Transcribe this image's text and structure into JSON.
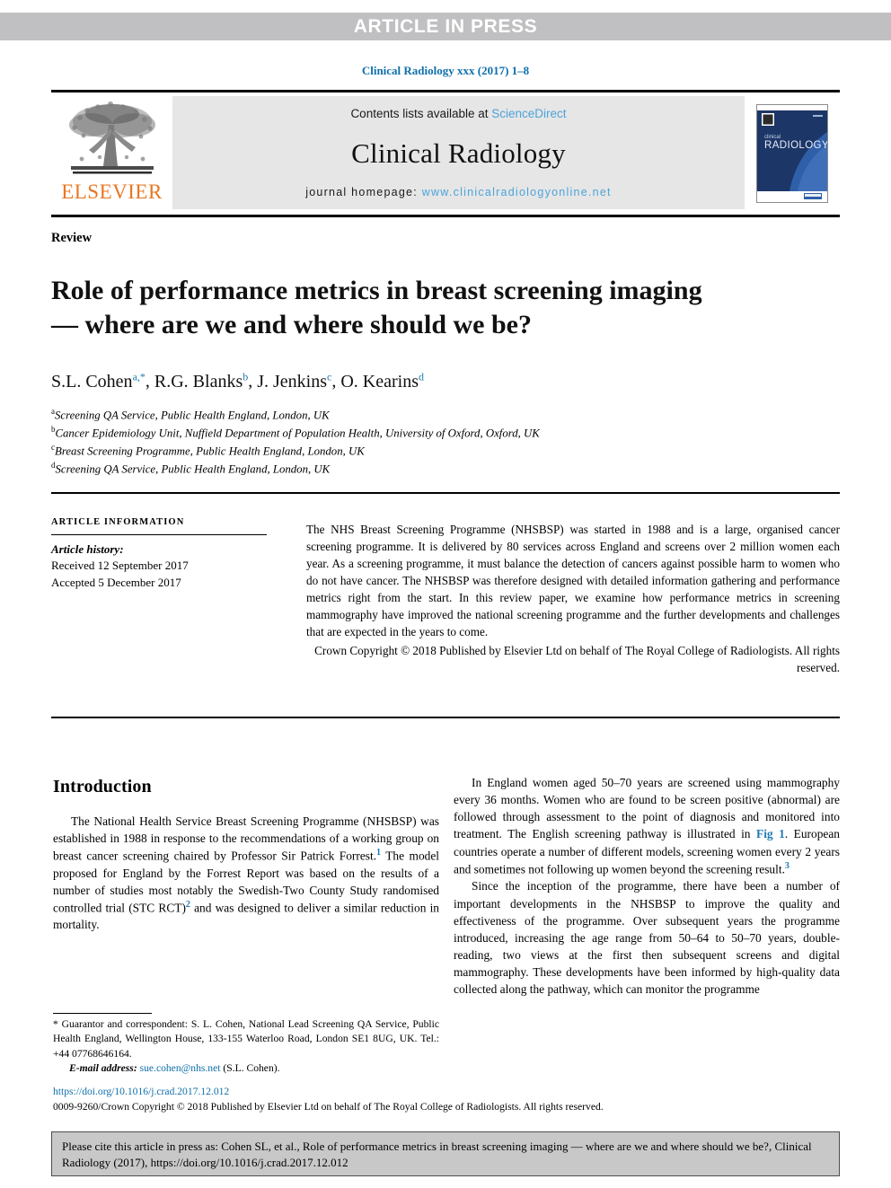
{
  "banner": {
    "text": "ARTICLE IN PRESS"
  },
  "journal_ref": "Clinical Radiology xxx (2017) 1–8",
  "masthead": {
    "publisher_word": "ELSEVIER",
    "contents_prefix": "Contents lists available at ",
    "contents_link": "ScienceDirect",
    "journal_name": "Clinical Radiology",
    "homepage_prefix": "journal homepage: ",
    "homepage_link": "www.clinicalradiologyonline.net",
    "cover_title_small": "clinical",
    "cover_title_large": "RADIOLOGY"
  },
  "article": {
    "section_label": "Review",
    "title": "Role of performance metrics in breast screening imaging — where are we and where should we be?",
    "authors": [
      {
        "name": "S.L. Cohen",
        "marks": "a,",
        "star": true
      },
      {
        "name": "R.G. Blanks",
        "marks": "b",
        "star": false
      },
      {
        "name": "J. Jenkins",
        "marks": "c",
        "star": false
      },
      {
        "name": "O. Kearins",
        "marks": "d",
        "star": false
      }
    ],
    "affiliations": [
      {
        "mark": "a",
        "text": "Screening QA Service, Public Health England, London, UK"
      },
      {
        "mark": "b",
        "text": "Cancer Epidemiology Unit, Nuffield Department of Population Health, University of Oxford, Oxford, UK"
      },
      {
        "mark": "c",
        "text": "Breast Screening Programme, Public Health England, London, UK"
      },
      {
        "mark": "d",
        "text": "Screening QA Service, Public Health England, London, UK"
      }
    ]
  },
  "article_information": {
    "heading": "ARTICLE INFORMATION",
    "history_label": "Article history:",
    "received": "Received 12 September 2017",
    "accepted": "Accepted 5 December 2017"
  },
  "abstract": {
    "text": "The NHS Breast Screening Programme (NHSBSP) was started in 1988 and is a large, organised cancer screening programme. It is delivered by 80 services across England and screens over 2 million women each year. As a screening programme, it must balance the detection of cancers against possible harm to women who do not have cancer. The NHSBSP was therefore designed with detailed information gathering and performance metrics right from the start. In this review paper, we examine how performance metrics in screening mammography have improved the national screening programme and the further developments and challenges that are expected in the years to come.",
    "copyright": "Crown Copyright © 2018 Published by Elsevier Ltd on behalf of The Royal College of Radiologists. All rights reserved."
  },
  "body": {
    "intro_heading": "Introduction",
    "left_p1_a": "The National Health Service Breast Screening Programme (NHSBSP) was established in 1988 in response to the recommendations of a working group on breast cancer screening chaired by Professor Sir Patrick Forrest.",
    "left_p1_ref1": "1",
    "left_p1_b": " The model proposed for England by the Forrest Report was based on the results of a number of studies most notably the Swedish-Two County Study randomised controlled trial (STC RCT)",
    "left_p1_ref2": "2",
    "left_p1_c": " and was designed to deliver a similar reduction in mortality.",
    "right_p1_a": "In England women aged 50–70 years are screened using mammography every 36 months. Women who are found to be screen positive (abnormal) are followed through assessment to the point of diagnosis and monitored into treatment. The English screening pathway is illustrated in ",
    "right_p1_figlink": "Fig 1",
    "right_p1_b": ". European countries operate a number of different models, screening women every 2 years and sometimes not following up women beyond the screening result.",
    "right_p1_ref3": "3",
    "right_p2": "Since the inception of the programme, there have been a number of important developments in the NHSBSP to improve the quality and effectiveness of the programme. Over subsequent years the programme introduced, increasing the age range from 50–64 to 50–70 years, double-reading, two views at the first then subsequent screens and digital mammography. These developments have been informed by high-quality data collected along the pathway, which can monitor the programme"
  },
  "footnotes": {
    "correspondence": "* Guarantor and correspondent: S. L. Cohen, National Lead Screening QA Service, Public Health England, Wellington House, 133-155 Waterloo Road, London SE1 8UG, UK. Tel.: +44 07768646164.",
    "email_label": "E-mail address:",
    "email": "sue.cohen@nhs.net",
    "email_suffix": "(S.L. Cohen)."
  },
  "doi_block": {
    "doi_url": "https://doi.org/10.1016/j.crad.2017.12.012",
    "issn_line": "0009-9260/Crown Copyright © 2018 Published by Elsevier Ltd on behalf of The Royal College of Radiologists. All rights reserved."
  },
  "cite_box": {
    "text": "Please cite this article in press as: Cohen SL, et al., Role of performance metrics in breast screening imaging — where are we and where should we be?, Clinical Radiology (2017), https://doi.org/10.1016/j.crad.2017.12.012"
  },
  "colors": {
    "banner_bg": "#c0c0c2",
    "link_blue": "#0f6fab",
    "light_blue": "#4ba3da",
    "elsevier_orange": "#e87722",
    "cover_navy": "#1c3667",
    "cover_blue": "#2f5fa8",
    "cite_bg": "#c8c8c8"
  }
}
